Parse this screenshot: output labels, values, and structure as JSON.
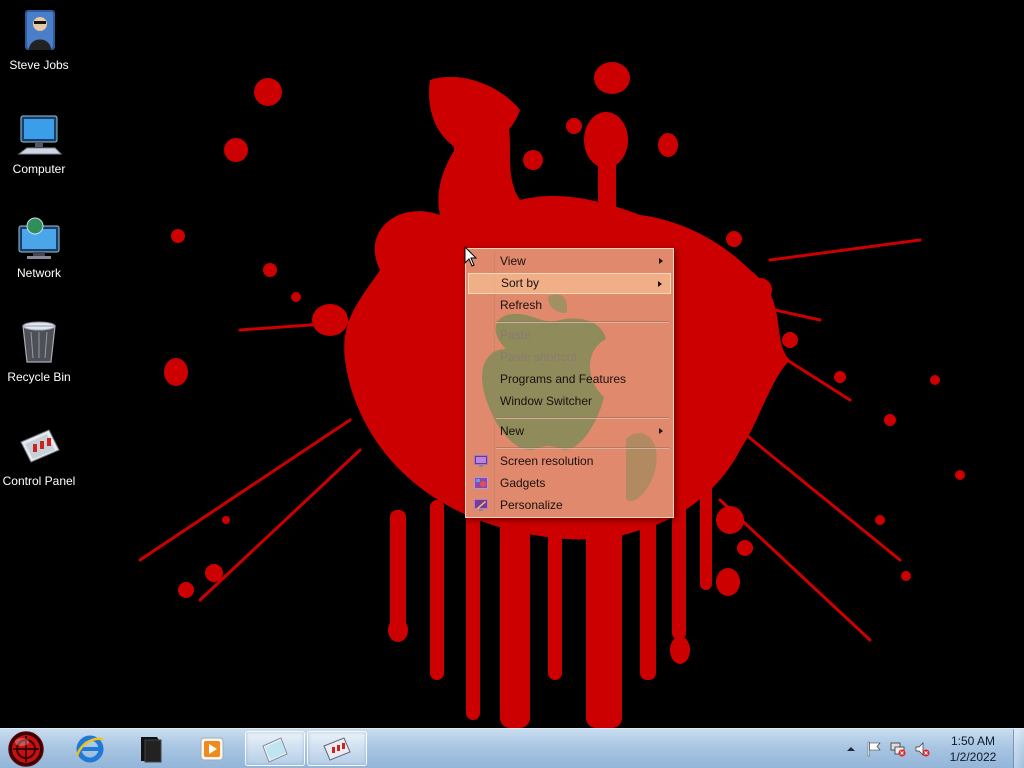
{
  "desktop_icons": [
    {
      "label": "Steve Jobs",
      "icon": "user-folder-icon"
    },
    {
      "label": "Computer",
      "icon": "computer-icon"
    },
    {
      "label": "Network",
      "icon": "network-icon"
    },
    {
      "label": "Recycle Bin",
      "icon": "recycle-bin-icon"
    },
    {
      "label": "Control Panel",
      "icon": "control-panel-icon"
    }
  ],
  "context_menu": {
    "items": [
      {
        "label": "View",
        "submenu": true
      },
      {
        "label": "Sort by",
        "submenu": true,
        "highlighted": true
      },
      {
        "label": "Refresh"
      },
      {
        "label": "Paste",
        "disabled": true
      },
      {
        "label": "Paste shortcut",
        "disabled": true
      },
      {
        "label": "Programs and Features"
      },
      {
        "label": "Window Switcher"
      },
      {
        "label": "New",
        "submenu": true
      },
      {
        "label": "Screen resolution",
        "icon": "screen-resolution-icon"
      },
      {
        "label": "Gadgets",
        "icon": "gadgets-icon"
      },
      {
        "label": "Personalize",
        "icon": "personalize-icon"
      }
    ]
  },
  "taskbar": {
    "start_icon": "start-orb-icon",
    "pinned": [
      {
        "icon": "internet-explorer-icon"
      },
      {
        "icon": "folder-icon"
      },
      {
        "icon": "media-player-icon"
      },
      {
        "icon": "notepad-icon",
        "active": true
      },
      {
        "icon": "control-panel-icon",
        "active": true
      }
    ],
    "tray": {
      "icons": [
        "show-hidden-icons-chevron",
        "action-center-flag-icon",
        "network-error-icon",
        "volume-muted-icon"
      ],
      "time": "1:50 AM",
      "date": "1/2/2022"
    }
  },
  "colors": {
    "wallpaper_background": "#000000",
    "blood_splatter": "#d10000",
    "menu_background": "#e8be96",
    "taskbar": "#a9c6e3"
  }
}
